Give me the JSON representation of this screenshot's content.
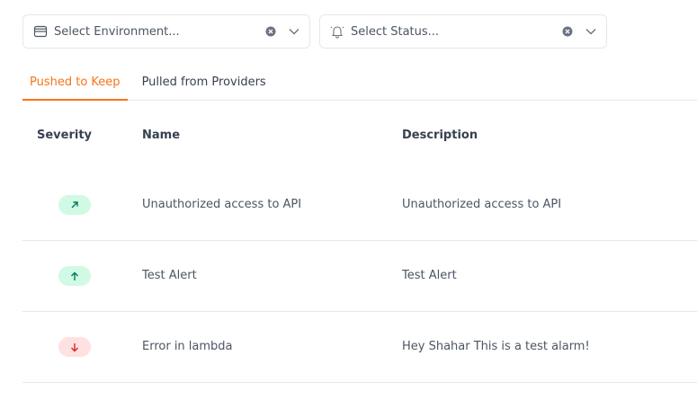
{
  "filters": {
    "environment": {
      "placeholder": "Select Environment...",
      "icon": "database-icon"
    },
    "status": {
      "placeholder": "Select Status...",
      "icon": "bell-icon"
    }
  },
  "tabs": [
    {
      "label": "Pushed to Keep",
      "active": true
    },
    {
      "label": "Pulled from Providers",
      "active": false
    }
  ],
  "table": {
    "columns": [
      "Severity",
      "Name",
      "Description"
    ],
    "rows": [
      {
        "severity": "high",
        "severity_icon": "arrow-up-right-icon",
        "severity_color": "#10b981",
        "name": "Unauthorized access to API",
        "description": "Unauthorized access to API"
      },
      {
        "severity": "critical",
        "severity_icon": "arrow-up-icon",
        "severity_color": "#10b981",
        "name": "Test Alert",
        "description": "Test Alert"
      },
      {
        "severity": "low",
        "severity_icon": "arrow-down-icon",
        "severity_color": "#ef4444",
        "name": "Error in lambda",
        "description": "Hey Shahar This is a test alarm!"
      }
    ]
  },
  "colors": {
    "accent": "#f97316",
    "border": "#e5e7eb"
  }
}
